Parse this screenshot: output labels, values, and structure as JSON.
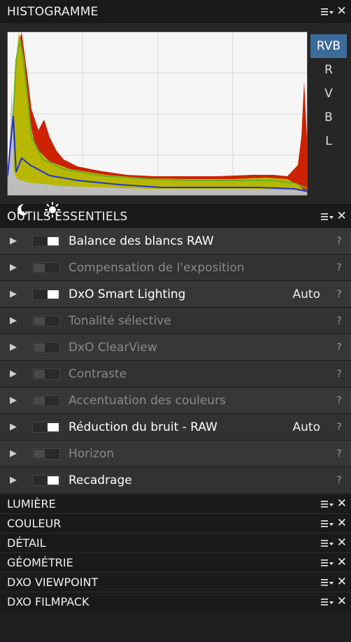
{
  "histogram": {
    "title": "HISTOGRAMME",
    "channels": [
      "RVB",
      "R",
      "V",
      "B",
      "L"
    ],
    "active_channel": "RVB",
    "icons": [
      "moon-icon",
      "sun-icon"
    ]
  },
  "essentials": {
    "title": "OUTILS ESSENTIELS",
    "tools": [
      {
        "label": "Balance des blancs RAW",
        "enabled": true,
        "value": ""
      },
      {
        "label": "Compensation de l'exposition",
        "enabled": false,
        "value": ""
      },
      {
        "label": "DxO Smart Lighting",
        "enabled": true,
        "value": "Auto"
      },
      {
        "label": "Tonalité sélective",
        "enabled": false,
        "value": ""
      },
      {
        "label": "DxO ClearView",
        "enabled": false,
        "value": ""
      },
      {
        "label": "Contraste",
        "enabled": false,
        "value": ""
      },
      {
        "label": "Accentuation des couleurs",
        "enabled": false,
        "value": ""
      },
      {
        "label": "Réduction du bruit - RAW",
        "enabled": true,
        "value": "Auto"
      },
      {
        "label": "Horizon",
        "enabled": false,
        "value": ""
      },
      {
        "label": "Recadrage",
        "enabled": true,
        "value": ""
      }
    ],
    "help_label": "?"
  },
  "sections": [
    "LUMIÈRE",
    "COULEUR",
    "DÉTAIL",
    "GÉOMÉTRIE",
    "DXO VIEWPOINT",
    "DXO FILMPACK"
  ],
  "close_label": "✕",
  "colors": {
    "accent": "#3d6b9a",
    "red": "#cc2200",
    "yellow": "#b8b800",
    "green": "#6ab022",
    "blue": "#2233cc"
  }
}
